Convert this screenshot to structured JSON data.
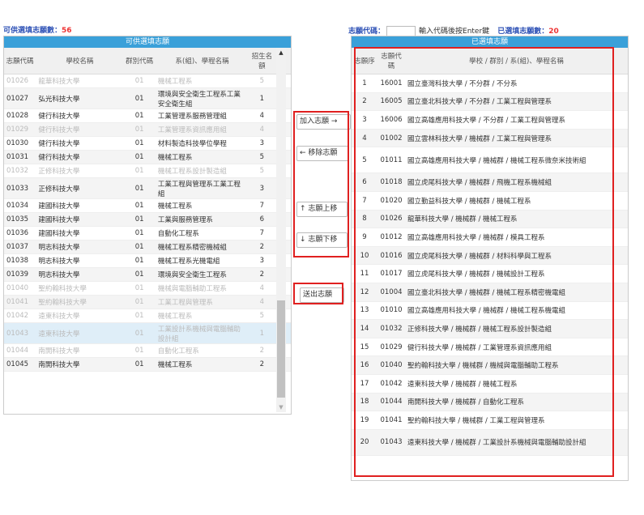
{
  "left_count": {
    "label": "可供選填志願數：",
    "value": "56"
  },
  "right_header": {
    "code_label": "志願代碼：",
    "hint": "輸入代碼後按Enter鍵",
    "filled_label": "已選填志願數：",
    "filled_value": "20"
  },
  "left_panel": {
    "title": "可供選填志願",
    "headers": [
      "志願代碼",
      "學校名稱",
      "群別代碼",
      "系(組)、學程名稱",
      "招生名額"
    ],
    "rows": [
      {
        "code": "01026",
        "school": "龍華科技大學",
        "group": "01",
        "dept": "機械工程系",
        "quota": "5",
        "state": "dim"
      },
      {
        "code": "01027",
        "school": "弘光科技大學",
        "group": "01",
        "dept": "環境與安全衛生工程系工業安全衛生組",
        "quota": "1",
        "state": "normal"
      },
      {
        "code": "01028",
        "school": "健行科技大學",
        "group": "01",
        "dept": "工業管理系服務管理組",
        "quota": "4",
        "state": "normal"
      },
      {
        "code": "01029",
        "school": "健行科技大學",
        "group": "01",
        "dept": "工業管理系資訊應用組",
        "quota": "4",
        "state": "dim"
      },
      {
        "code": "01030",
        "school": "健行科技大學",
        "group": "01",
        "dept": "材料製造科技學位學程",
        "quota": "3",
        "state": "normal"
      },
      {
        "code": "01031",
        "school": "健行科技大學",
        "group": "01",
        "dept": "機械工程系",
        "quota": "5",
        "state": "normal"
      },
      {
        "code": "01032",
        "school": "正修科技大學",
        "group": "01",
        "dept": "機械工程系設計製造組",
        "quota": "5",
        "state": "dim"
      },
      {
        "code": "01033",
        "school": "正修科技大學",
        "group": "01",
        "dept": "工業工程與管理系工業工程組",
        "quota": "3",
        "state": "normal"
      },
      {
        "code": "01034",
        "school": "建國科技大學",
        "group": "01",
        "dept": "機械工程系",
        "quota": "7",
        "state": "normal"
      },
      {
        "code": "01035",
        "school": "建國科技大學",
        "group": "01",
        "dept": "工業與服務管理系",
        "quota": "6",
        "state": "normal"
      },
      {
        "code": "01036",
        "school": "建國科技大學",
        "group": "01",
        "dept": "自動化工程系",
        "quota": "7",
        "state": "normal"
      },
      {
        "code": "01037",
        "school": "明志科技大學",
        "group": "01",
        "dept": "機械工程系精密機械組",
        "quota": "2",
        "state": "normal"
      },
      {
        "code": "01038",
        "school": "明志科技大學",
        "group": "01",
        "dept": "機械工程系光機電組",
        "quota": "3",
        "state": "normal"
      },
      {
        "code": "01039",
        "school": "明志科技大學",
        "group": "01",
        "dept": "環境與安全衛生工程系",
        "quota": "2",
        "state": "normal"
      },
      {
        "code": "01040",
        "school": "聖約翰科技大學",
        "group": "01",
        "dept": "機械與電腦輔助工程系",
        "quota": "4",
        "state": "dim"
      },
      {
        "code": "01041",
        "school": "聖約翰科技大學",
        "group": "01",
        "dept": "工業工程與管理系",
        "quota": "4",
        "state": "dim"
      },
      {
        "code": "01042",
        "school": "遠東科技大學",
        "group": "01",
        "dept": "機械工程系",
        "quota": "5",
        "state": "dim"
      },
      {
        "code": "01043",
        "school": "遠東科技大學",
        "group": "01",
        "dept": "工業設計系機械與電腦輔助設計組",
        "quota": "1",
        "state": "selected"
      },
      {
        "code": "01044",
        "school": "南開科技大學",
        "group": "01",
        "dept": "自動化工程系",
        "quota": "2",
        "state": "dim"
      },
      {
        "code": "01045",
        "school": "南開科技大學",
        "group": "01",
        "dept": "機械工程系",
        "quota": "2",
        "state": "normal"
      }
    ]
  },
  "buttons": {
    "add": "加入志願 →",
    "remove": "← 移除志願",
    "up": "↑ 志願上移",
    "down": "↓ 志願下移",
    "send": "送出志願"
  },
  "right_panel": {
    "title": "已選填志願",
    "headers": [
      "志願序",
      "志願代碼",
      "學校 / 群別 / 系(組)、學程名稱"
    ],
    "rows": [
      {
        "order": "1",
        "code": "16001",
        "name": "國立臺灣科技大學 / 不分群 / 不分系"
      },
      {
        "order": "2",
        "code": "16005",
        "name": "國立臺北科技大學 / 不分群 / 工業工程與管理系"
      },
      {
        "order": "3",
        "code": "16006",
        "name": "國立高雄應用科技大學 / 不分群 / 工業工程與管理系"
      },
      {
        "order": "4",
        "code": "01002",
        "name": "國立雲林科技大學 / 機械群 / 工業工程與管理系"
      },
      {
        "order": "5",
        "code": "01011",
        "name": "國立高雄應用科技大學 / 機械群 / 機械工程系微奈米技術組"
      },
      {
        "order": "6",
        "code": "01018",
        "name": "國立虎尾科技大學 / 機械群 / 飛機工程系機械組"
      },
      {
        "order": "7",
        "code": "01020",
        "name": "國立勤益科技大學 / 機械群 / 機械工程系"
      },
      {
        "order": "8",
        "code": "01026",
        "name": "龍華科技大學 / 機械群 / 機械工程系"
      },
      {
        "order": "9",
        "code": "01012",
        "name": "國立高雄應用科技大學 / 機械群 / 模具工程系"
      },
      {
        "order": "10",
        "code": "01016",
        "name": "國立虎尾科技大學 / 機械群 / 材料科學與工程系"
      },
      {
        "order": "11",
        "code": "01017",
        "name": "國立虎尾科技大學 / 機械群 / 機械設計工程系"
      },
      {
        "order": "12",
        "code": "01004",
        "name": "國立臺北科技大學 / 機械群 / 機械工程系精密機電組"
      },
      {
        "order": "13",
        "code": "01010",
        "name": "國立高雄應用科技大學 / 機械群 / 機械工程系機電組"
      },
      {
        "order": "14",
        "code": "01032",
        "name": "正修科技大學 / 機械群 / 機械工程系設計製造組"
      },
      {
        "order": "15",
        "code": "01029",
        "name": "健行科技大學 / 機械群 / 工業管理系資訊應用組"
      },
      {
        "order": "16",
        "code": "01040",
        "name": "聖約翰科技大學 / 機械群 / 機械與電腦輔助工程系"
      },
      {
        "order": "17",
        "code": "01042",
        "name": "遠東科技大學 / 機械群 / 機械工程系"
      },
      {
        "order": "18",
        "code": "01044",
        "name": "南開科技大學 / 機械群 / 自動化工程系"
      },
      {
        "order": "19",
        "code": "01041",
        "name": "聖約翰科技大學 / 機械群 / 工業工程與管理系"
      },
      {
        "order": "20",
        "code": "01043",
        "name": "遠東科技大學 / 機械群 / 工業設計系機械與電腦輔助設計組"
      }
    ]
  }
}
